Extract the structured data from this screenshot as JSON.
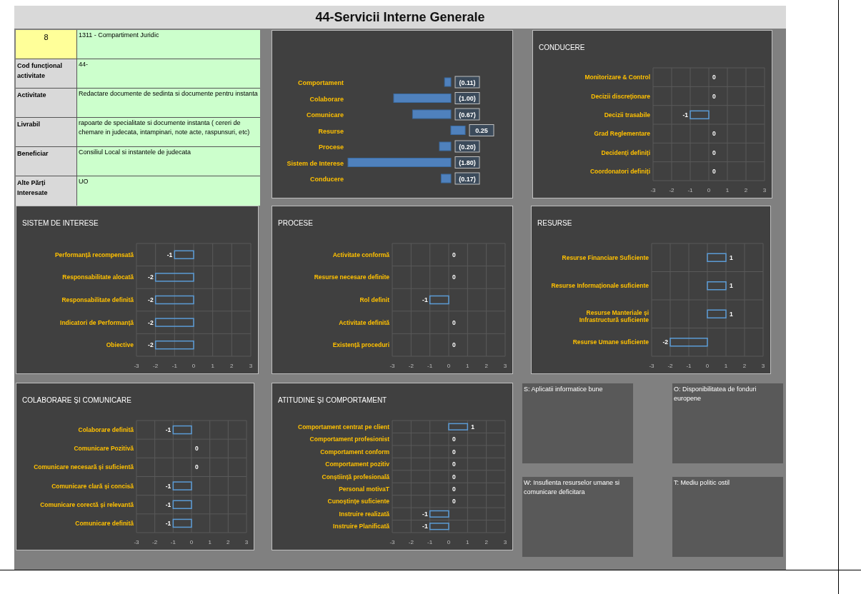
{
  "title": "44-Servicii Interne Generale",
  "info_table": {
    "number": "8",
    "unit": "1311 - Compartiment Juridic",
    "rows": [
      {
        "label": "Cod funcțional activitate",
        "value": "44-"
      },
      {
        "label": "Activitate",
        "value": "Redactare documente de sedinta si documente pentru instanta"
      },
      {
        "label": "Livrabil",
        "value": "rapoarte de specialitate si documente instanta ( cereri de chemare in judecata, intampinari, note acte, raspunsuri, etc)"
      },
      {
        "label": "Beneficiar",
        "value": "Consiliul Local si instantele de judecata"
      },
      {
        "label": "Alte Părți Interesate",
        "value": "UO"
      }
    ]
  },
  "summary_chart": {
    "chart_data": {
      "type": "bar",
      "orientation": "horizontal",
      "categories": [
        "Comportament",
        "Colaborare",
        "Comunicare",
        "Resurse",
        "Procese",
        "Sistem de Interese",
        "Conducere"
      ],
      "values": [
        -0.11,
        -1.0,
        -0.67,
        0.25,
        -0.2,
        -1.8,
        -0.17
      ],
      "value_labels": [
        "(0.11)",
        "(1.00)",
        "(0.67)",
        "0.25",
        "(0.20)",
        "(1.80)",
        "(0.17)"
      ]
    }
  },
  "charts": [
    {
      "chart_data": {
        "type": "bar",
        "orientation": "horizontal",
        "title": "CONDUCERE",
        "categories": [
          "Monitorizare & Control",
          "Decizii discreționare",
          "Decizii trasabile",
          "Grad Reglementare",
          "Decidenți definiți",
          "Coordonatori definiți"
        ],
        "values": [
          0,
          0,
          -1,
          0,
          0,
          0
        ],
        "xlim": [
          -3,
          3
        ],
        "xticks": [
          -3,
          -2,
          -1,
          0,
          1,
          2,
          3
        ],
        "data_labels": true,
        "grid": true
      }
    },
    {
      "chart_data": {
        "type": "bar",
        "orientation": "horizontal",
        "title": "SISTEM DE INTERESE",
        "categories": [
          "Performanță recompensată",
          "Responsabilitate alocată",
          "Responsabilitate definită",
          "Indicatori de Performanță",
          "Obiective"
        ],
        "values": [
          -1,
          -2,
          -2,
          -2,
          -2
        ],
        "xlim": [
          -3,
          3
        ],
        "xticks": [
          -3,
          -2,
          -1,
          0,
          1,
          2,
          3
        ],
        "data_labels": true,
        "grid": true
      }
    },
    {
      "chart_data": {
        "type": "bar",
        "orientation": "horizontal",
        "title": "PROCESE",
        "categories": [
          "Activitate conformă",
          "Resurse necesare definite",
          "Rol definit",
          "Activitate definită",
          "Existență proceduri"
        ],
        "values": [
          0,
          0,
          -1,
          0,
          0
        ],
        "xlim": [
          -3,
          3
        ],
        "xticks": [
          -3,
          -2,
          -1,
          0,
          1,
          2,
          3
        ],
        "data_labels": true,
        "grid": true
      }
    },
    {
      "chart_data": {
        "type": "bar",
        "orientation": "horizontal",
        "title": "RESURSE",
        "categories": [
          "Resurse Financiare Suficiente",
          "Resurse Informaționale suficiente",
          "Resurse Manteriale și Infrastructură suficiente",
          "Resurse Umane suficiente"
        ],
        "values": [
          1,
          1,
          1,
          -2
        ],
        "xlim": [
          -3,
          3
        ],
        "xticks": [
          -3,
          -2,
          -1,
          0,
          1,
          2,
          3
        ],
        "data_labels": true,
        "grid": true
      }
    },
    {
      "chart_data": {
        "type": "bar",
        "orientation": "horizontal",
        "title": "COLABORARE ȘI COMUNICARE",
        "categories": [
          "Colaborare definită",
          "Comunicare Pozitivă",
          "Comunicare necesară și suficientă",
          "Comunicare clară și concisă",
          "Comunicare corectă și relevantă",
          "Comunicare definită"
        ],
        "values": [
          -1,
          0,
          0,
          -1,
          -1,
          -1
        ],
        "xlim": [
          -3,
          3
        ],
        "xticks": [
          -3,
          -2,
          -1,
          0,
          1,
          2,
          3
        ],
        "data_labels": true,
        "grid": true
      }
    },
    {
      "chart_data": {
        "type": "bar",
        "orientation": "horizontal",
        "title": "ATITUDINE ȘI COMPORTAMENT",
        "categories": [
          "Comportament centrat pe client",
          "Comportament profesionist",
          "Comportament conform",
          "Comportament pozitiv",
          "Conștiință profesională",
          "Personal motivaT",
          "Cunoștințe suficiente",
          "Instruire realizată",
          "Instruire Planificată"
        ],
        "values": [
          1,
          0,
          0,
          0,
          0,
          0,
          0,
          -1,
          -1
        ],
        "xlim": [
          -3,
          3
        ],
        "xticks": [
          -3,
          -2,
          -1,
          0,
          1,
          2,
          3
        ],
        "data_labels": true,
        "grid": true
      }
    }
  ],
  "swot": [
    {
      "text": "S: Aplicatii informatice bune"
    },
    {
      "text": "O: Disponibilitatea de fonduri europene"
    },
    {
      "text": "W: Insufienta resurselor umane si comunicare deficitara"
    },
    {
      "text": "T: Mediu politic ostil"
    }
  ]
}
